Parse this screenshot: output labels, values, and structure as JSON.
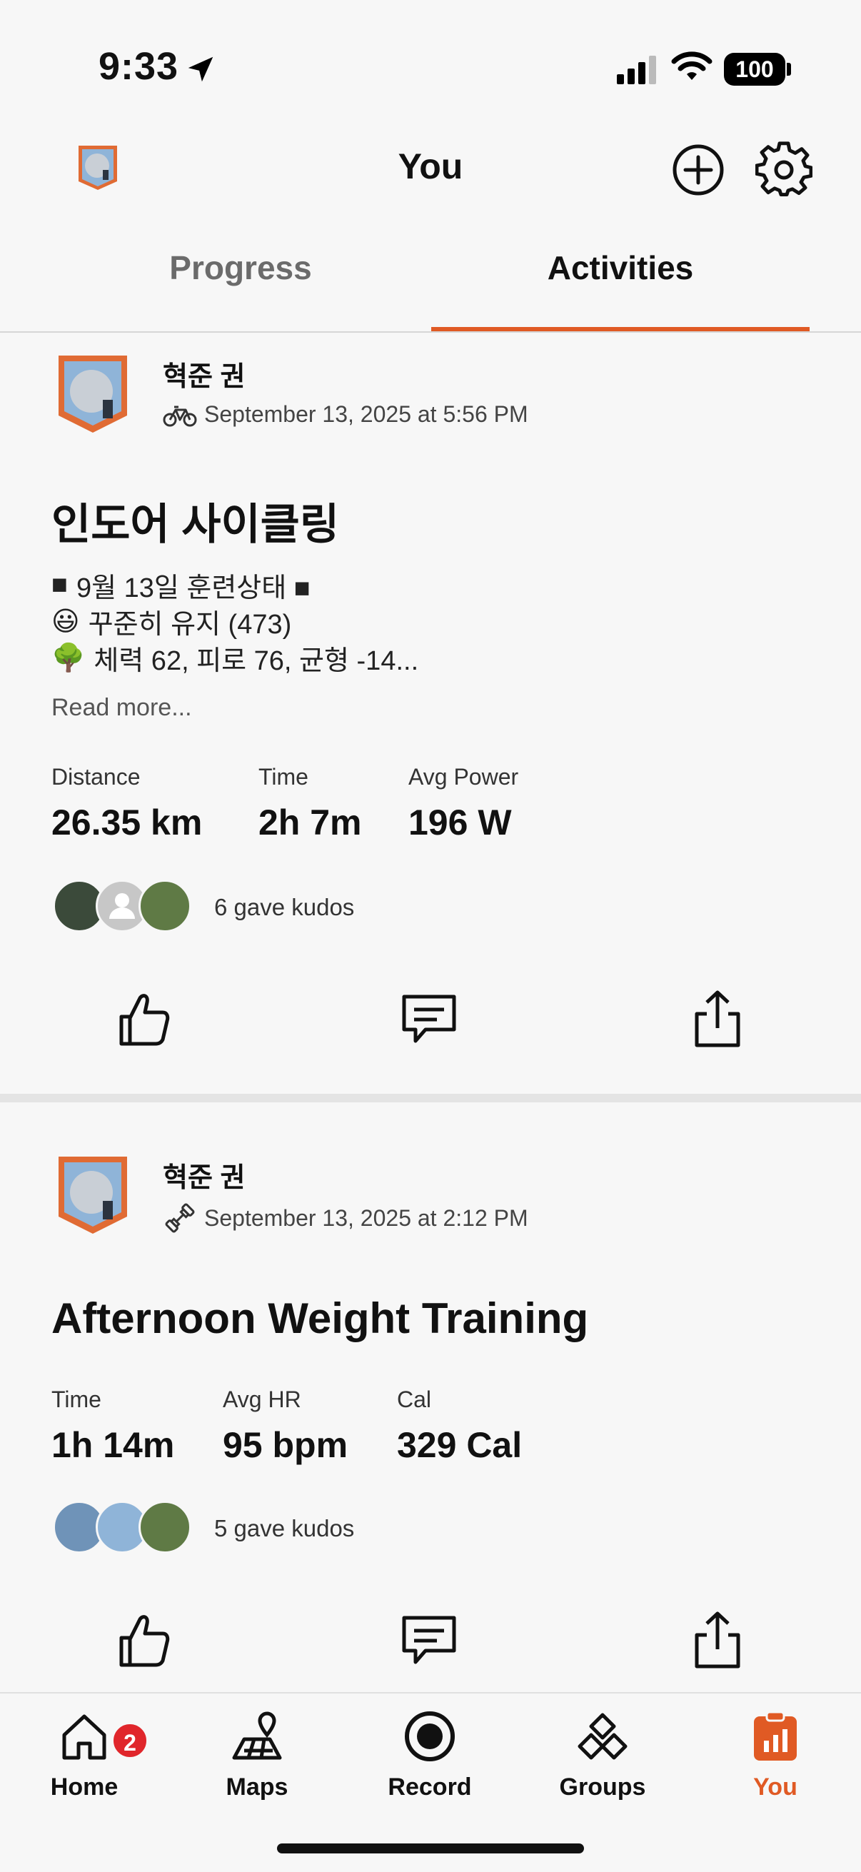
{
  "status_bar": {
    "time": "9:33",
    "battery": "100"
  },
  "header": {
    "title": "You"
  },
  "tabs": [
    {
      "label": "Progress"
    },
    {
      "label": "Activities"
    }
  ],
  "activities": [
    {
      "athlete": "혁준 권",
      "sport_icon": "bike-icon",
      "meta": "September 13, 2025 at 5:56 PM",
      "title": "인도어 사이클링",
      "description": [
        {
          "emoji": "■",
          "text": "9월 13일 훈련상태 ■"
        },
        {
          "emoji": "😃",
          "text": "꾸준히 유지 (473)"
        },
        {
          "emoji": "🌳",
          "text": "체력 62, 피로 76, 균형 -14..."
        }
      ],
      "read_more": "Read more...",
      "stats": [
        {
          "label": "Distance",
          "value": "26.35 km"
        },
        {
          "label": "Time",
          "value": "2h 7m"
        },
        {
          "label": "Avg Power",
          "value": "196 W"
        }
      ],
      "kudos": "6 gave kudos"
    },
    {
      "athlete": "혁준 권",
      "sport_icon": "dumbbell-icon",
      "meta": "September 13, 2025 at 2:12 PM",
      "title": "Afternoon Weight Training",
      "stats": [
        {
          "label": "Time",
          "value": "1h 14m"
        },
        {
          "label": "Avg HR",
          "value": "95 bpm"
        },
        {
          "label": "Cal",
          "value": "329 Cal"
        }
      ],
      "kudos": "5 gave kudos"
    }
  ],
  "bottom_nav": {
    "items": [
      {
        "label": "Home",
        "badge": "2"
      },
      {
        "label": "Maps"
      },
      {
        "label": "Record"
      },
      {
        "label": "Groups"
      },
      {
        "label": "You"
      }
    ],
    "accent": "#e05a24"
  }
}
